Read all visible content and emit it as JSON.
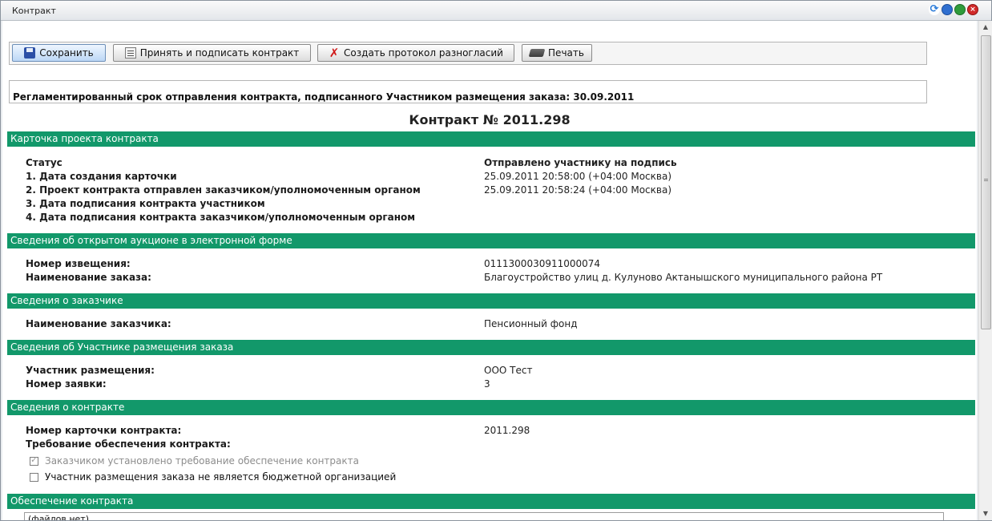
{
  "window": {
    "title": "Контракт"
  },
  "titlebar_icons": [
    "refresh-icon",
    "minimize-icon",
    "maximize-icon",
    "close-icon"
  ],
  "toolbar": {
    "save": "Сохранить",
    "accept_sign": "Принять и подписать контракт",
    "create_protocol": "Создать протокол разногласий",
    "print": "Печать"
  },
  "notice": "Регламентированный срок отправления контракта, подписанного Участником размещения заказа: 30.09.2011",
  "doc_title": "Контракт № 2011.298",
  "sections": {
    "card": "Карточка проекта контракта",
    "auction": "Сведения об открытом аукционе в электронной форме",
    "customer": "Сведения о заказчике",
    "participant": "Сведения об Участнике размещения заказа",
    "contract": "Сведения о контракте",
    "security": "Обеспечение контракта"
  },
  "card_rows": [
    {
      "label": "Статус",
      "value": "Отправлено участнику на подпись"
    },
    {
      "label": "1. Дата создания карточки",
      "value": "25.09.2011 20:58:00 (+04:00 Москва)"
    },
    {
      "label": "2. Проект контракта отправлен заказчиком/уполномоченным органом",
      "value": "25.09.2011 20:58:24 (+04:00 Москва)"
    },
    {
      "label": "3. Дата подписания контракта участником",
      "value": ""
    },
    {
      "label": "4. Дата подписания контракта заказчиком/уполномоченным органом",
      "value": ""
    }
  ],
  "auction_rows": [
    {
      "label": "Номер извещения:",
      "value": "0111300030911000074"
    },
    {
      "label": "Наименование заказа:",
      "value": "Благоустройство улиц д. Кулуново Актанышского муниципального района РТ"
    }
  ],
  "customer_rows": [
    {
      "label": "Наименование заказчика:",
      "value": "Пенсионный фонд"
    }
  ],
  "participant_rows": [
    {
      "label": "Участник размещения:",
      "value": "ООО Тест"
    },
    {
      "label": "Номер заявки:",
      "value": "3"
    }
  ],
  "contract_rows": [
    {
      "label": "Номер карточки контракта:",
      "value": "2011.298"
    },
    {
      "label": "Требование обеспечения контракта:",
      "value": ""
    }
  ],
  "checkboxes": [
    {
      "label": "Заказчиком установлено требование обеспечение контракта",
      "checked": true,
      "disabled": true
    },
    {
      "label": "Участник размещения заказа не является бюджетной организацией",
      "checked": false,
      "disabled": false
    }
  ],
  "files_placeholder": "(файлов нет)"
}
